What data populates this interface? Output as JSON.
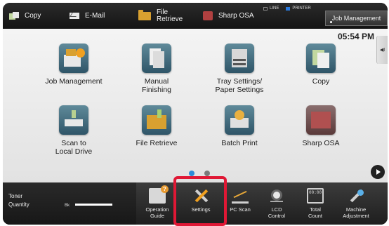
{
  "top_bar": {
    "modes": [
      {
        "label": "Copy",
        "icon": "copy-icon"
      },
      {
        "label": "E-Mail",
        "icon": "email-icon"
      },
      {
        "label_line1": "File",
        "label_line2": "Retrieve",
        "icon": "folder-icon"
      },
      {
        "label": "Sharp OSA",
        "icon": "sharp-osa-icon"
      }
    ],
    "status": {
      "line": "LINE",
      "printer": "PRINTER",
      "printer_active": true
    },
    "job_management": "Job Management"
  },
  "main": {
    "clock": "05:54 PM",
    "side_tab_glyph": "◀I",
    "tiles": [
      {
        "label": "Job Management",
        "icon": "job-management-icon"
      },
      {
        "label_line1": "Manual",
        "label_line2": "Finishing",
        "icon": "manual-finishing-icon"
      },
      {
        "label_line1": "Tray Settings/",
        "label_line2": "Paper Settings",
        "icon": "tray-settings-icon"
      },
      {
        "label": "Copy",
        "icon": "copy-icon"
      },
      {
        "label_line1": "Scan to",
        "label_line2": "Local Drive",
        "icon": "scan-to-local-drive-icon"
      },
      {
        "label": "File Retrieve",
        "icon": "file-retrieve-icon"
      },
      {
        "label": "Batch Print",
        "icon": "batch-print-icon"
      },
      {
        "label": "Sharp OSA",
        "icon": "sharp-osa-icon"
      }
    ],
    "page_indicator": {
      "current": 1,
      "total": 2
    }
  },
  "bottom_bar": {
    "toner": {
      "label_line1": "Toner",
      "label_line2": "Quantity",
      "channel": "Bk",
      "level_fraction": 1.0
    },
    "items": [
      {
        "label_line1": "Operation",
        "label_line2": "Guide",
        "icon": "operation-guide-icon"
      },
      {
        "label": "Settings",
        "icon": "settings-icon",
        "highlighted": true
      },
      {
        "label": "PC Scan",
        "icon": "pc-scan-icon"
      },
      {
        "label_line1": "LCD",
        "label_line2": "Control",
        "icon": "lcd-control-icon"
      },
      {
        "label_line1": "Total",
        "label_line2": "Count",
        "icon": "total-count-icon"
      },
      {
        "label_line1": "Machine",
        "label_line2": "Adjustment",
        "icon": "machine-adjustment-icon"
      }
    ]
  },
  "colors": {
    "highlight": "#e01835",
    "page_dot_active": "#2d8bd8",
    "led_active": "#2a7be0"
  }
}
